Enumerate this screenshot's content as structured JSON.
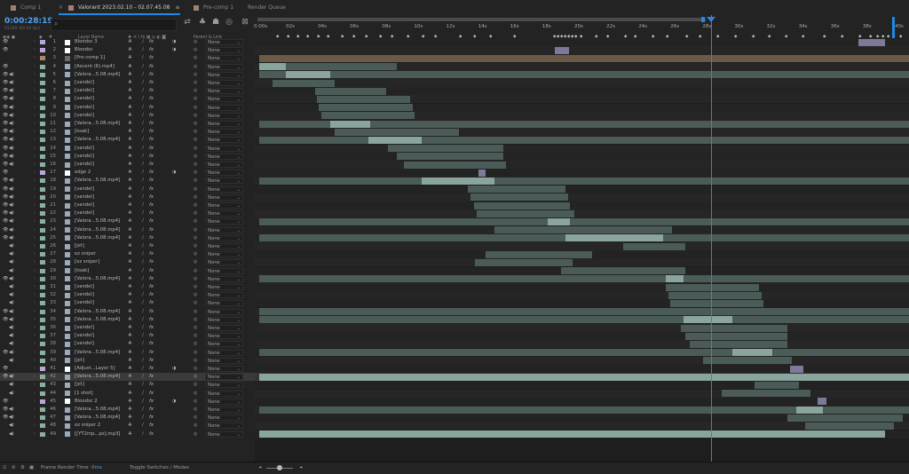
{
  "tabs": [
    {
      "label": "Comp 1",
      "color": "#a08070",
      "active": false
    },
    {
      "label": "Valorant 2023.02.10 - 02.07.45.08",
      "color": "#a08070",
      "active": true
    },
    {
      "label": "Pre-comp 1",
      "color": "#a08070",
      "active": false
    },
    {
      "label": "Render Queue",
      "color": "",
      "active": false
    }
  ],
  "icons": {
    "close": "×",
    "menu": "≡",
    "search": "⌕"
  },
  "timecode": "0:00:28:19",
  "fps": "01189 (60.00 fps)",
  "search": {
    "placeholder": ""
  },
  "columns": {
    "layer_name": "Layer Name",
    "parent_link": "Parent & Link"
  },
  "layers": [
    {
      "num": "1",
      "name": "Bloodsc 3",
      "label": "#b8a8d8",
      "src": "#ffffff",
      "mb": "◑",
      "eye": true,
      "aud": false
    },
    {
      "num": "2",
      "name": "Bloodsc",
      "label": "#b8a8d8",
      "src": "#ffffff",
      "mb": "◑",
      "eye": true,
      "aud": false
    },
    {
      "num": "3",
      "name": "[Pre-comp 1]",
      "label": "#a88870",
      "src": "#6a6a6a",
      "mb": "",
      "eye": false,
      "aud": false
    },
    {
      "num": "4",
      "name": "[Ascent (6).mp4]",
      "label": "#8ab0a0",
      "src": "#9ab",
      "mb": "",
      "eye": true,
      "aud": false
    },
    {
      "num": "5",
      "name": "[Valora...5.08.mp4]",
      "label": "#8ab0a0",
      "src": "#9ab",
      "mb": "",
      "eye": true,
      "aud": true
    },
    {
      "num": "6",
      "name": "[vandel]",
      "label": "#8ab0a0",
      "src": "#9ab",
      "mb": "",
      "eye": true,
      "aud": true
    },
    {
      "num": "7",
      "name": "[vandel]",
      "label": "#8ab0a0",
      "src": "#9ab",
      "mb": "",
      "eye": true,
      "aud": true
    },
    {
      "num": "8",
      "name": "[vandel]",
      "label": "#8ab0a0",
      "src": "#9ab",
      "mb": "",
      "eye": true,
      "aud": true
    },
    {
      "num": "9",
      "name": "[vandel]",
      "label": "#8ab0a0",
      "src": "#9ab",
      "mb": "",
      "eye": true,
      "aud": true
    },
    {
      "num": "10",
      "name": "[vandel]",
      "label": "#8ab0a0",
      "src": "#9ab",
      "mb": "",
      "eye": true,
      "aud": true
    },
    {
      "num": "11",
      "name": "[Valora...5.08.mp4]",
      "label": "#8ab0a0",
      "src": "#9ab",
      "mb": "",
      "eye": true,
      "aud": true
    },
    {
      "num": "12",
      "name": "[ksak]",
      "label": "#8ab0a0",
      "src": "#9ab",
      "mb": "",
      "eye": true,
      "aud": true
    },
    {
      "num": "13",
      "name": "[Valora...5.08.mp4]",
      "label": "#8ab0a0",
      "src": "#9ab",
      "mb": "",
      "eye": true,
      "aud": true
    },
    {
      "num": "14",
      "name": "[vandel]",
      "label": "#8ab0a0",
      "src": "#9ab",
      "mb": "",
      "eye": true,
      "aud": true
    },
    {
      "num": "15",
      "name": "[vandel]",
      "label": "#8ab0a0",
      "src": "#9ab",
      "mb": "",
      "eye": true,
      "aud": true
    },
    {
      "num": "16",
      "name": "[vandel]",
      "label": "#8ab0a0",
      "src": "#9ab",
      "mb": "",
      "eye": true,
      "aud": true
    },
    {
      "num": "17",
      "name": "edge 2",
      "label": "#b8a8d8",
      "src": "#ffffff",
      "mb": "◑",
      "eye": true,
      "aud": false
    },
    {
      "num": "18",
      "name": "[Valora...5.08.mp4]",
      "label": "#8ab0a0",
      "src": "#9ab",
      "mb": "",
      "eye": true,
      "aud": true
    },
    {
      "num": "19",
      "name": "[vandel]",
      "label": "#8ab0a0",
      "src": "#9ab",
      "mb": "",
      "eye": true,
      "aud": true
    },
    {
      "num": "20",
      "name": "[vandel]",
      "label": "#8ab0a0",
      "src": "#9ab",
      "mb": "",
      "eye": true,
      "aud": true
    },
    {
      "num": "21",
      "name": "[vandel]",
      "label": "#8ab0a0",
      "src": "#9ab",
      "mb": "",
      "eye": true,
      "aud": true
    },
    {
      "num": "22",
      "name": "[vandel]",
      "label": "#8ab0a0",
      "src": "#9ab",
      "mb": "",
      "eye": true,
      "aud": true
    },
    {
      "num": "23",
      "name": "[Valora...5.08.mp4]",
      "label": "#8ab0a0",
      "src": "#9ab",
      "mb": "",
      "eye": true,
      "aud": true
    },
    {
      "num": "24",
      "name": "[Valora...5.08.mp4]",
      "label": "#8ab0a0",
      "src": "#9ab",
      "mb": "",
      "eye": true,
      "aud": true
    },
    {
      "num": "25",
      "name": "[Valora...5.08.mp4]",
      "label": "#8ab0a0",
      "src": "#9ab",
      "mb": "",
      "eye": true,
      "aud": true
    },
    {
      "num": "26",
      "name": "[jet]",
      "label": "#8ab0a0",
      "src": "#9ab",
      "mb": "",
      "eye": false,
      "aud": true
    },
    {
      "num": "27",
      "name": "ez sniper",
      "label": "#8ab0a0",
      "src": "#9ab",
      "mb": "",
      "eye": false,
      "aud": true
    },
    {
      "num": "28",
      "name": "[ez sniper]",
      "label": "#8ab0a0",
      "src": "#9ab",
      "mb": "",
      "eye": false,
      "aud": true
    },
    {
      "num": "29",
      "name": "[ksak]",
      "label": "#8ab0a0",
      "src": "#9ab",
      "mb": "",
      "eye": false,
      "aud": true
    },
    {
      "num": "30",
      "name": "[Valora...5.08.mp4]",
      "label": "#8ab0a0",
      "src": "#9ab",
      "mb": "",
      "eye": true,
      "aud": true
    },
    {
      "num": "31",
      "name": "[vandel]",
      "label": "#8ab0a0",
      "src": "#9ab",
      "mb": "",
      "eye": false,
      "aud": true
    },
    {
      "num": "32",
      "name": "[vandel]",
      "label": "#8ab0a0",
      "src": "#9ab",
      "mb": "",
      "eye": false,
      "aud": true
    },
    {
      "num": "33",
      "name": "[vandel]",
      "label": "#8ab0a0",
      "src": "#9ab",
      "mb": "",
      "eye": false,
      "aud": true
    },
    {
      "num": "34",
      "name": "[Valora...5.08.mp4]",
      "label": "#8ab0a0",
      "src": "#9ab",
      "mb": "",
      "eye": true,
      "aud": true
    },
    {
      "num": "35",
      "name": "[Valora...5.08.mp4]",
      "label": "#8ab0a0",
      "src": "#9ab",
      "mb": "",
      "eye": true,
      "aud": true
    },
    {
      "num": "36",
      "name": "[vandel]",
      "label": "#8ab0a0",
      "src": "#9ab",
      "mb": "",
      "eye": false,
      "aud": true
    },
    {
      "num": "37",
      "name": "[vandel]",
      "label": "#8ab0a0",
      "src": "#9ab",
      "mb": "",
      "eye": false,
      "aud": true
    },
    {
      "num": "38",
      "name": "[vandel]",
      "label": "#8ab0a0",
      "src": "#9ab",
      "mb": "",
      "eye": false,
      "aud": true
    },
    {
      "num": "39",
      "name": "[Valora...5.08.mp4]",
      "label": "#8ab0a0",
      "src": "#9ab",
      "mb": "",
      "eye": true,
      "aud": true
    },
    {
      "num": "40",
      "name": "[jet]",
      "label": "#8ab0a0",
      "src": "#9ab",
      "mb": "",
      "eye": false,
      "aud": true
    },
    {
      "num": "41",
      "name": "[Adjust...Layer 5]",
      "label": "#b8a8d8",
      "src": "#ffffff",
      "mb": "◑",
      "eye": true,
      "aud": false
    },
    {
      "num": "42",
      "name": "[Valora...5.08.mp4]",
      "label": "#8ab0a0",
      "src": "#9ab",
      "mb": "",
      "eye": true,
      "aud": true,
      "selected": true
    },
    {
      "num": "43",
      "name": "[jet]",
      "label": "#8ab0a0",
      "src": "#9ab",
      "mb": "",
      "eye": false,
      "aud": true
    },
    {
      "num": "44",
      "name": "[1 shot]",
      "label": "#8ab0a0",
      "src": "#9ab",
      "mb": "",
      "eye": false,
      "aud": true
    },
    {
      "num": "45",
      "name": "Bloodsc 2",
      "label": "#b8a8d8",
      "src": "#ffffff",
      "mb": "◑",
      "eye": true,
      "aud": false
    },
    {
      "num": "46",
      "name": "[Valora...5.08.mp4]",
      "label": "#8ab0a0",
      "src": "#9ab",
      "mb": "",
      "eye": true,
      "aud": true
    },
    {
      "num": "47",
      "name": "[Valora...5.08.mp4]",
      "label": "#8ab0a0",
      "src": "#9ab",
      "mb": "",
      "eye": true,
      "aud": true
    },
    {
      "num": "48",
      "name": "ez sniper 2",
      "label": "#8ab0a0",
      "src": "#9ab",
      "mb": "",
      "eye": false,
      "aud": true
    },
    {
      "num": "49",
      "name": "[[YT2mp...ps].mp3]",
      "label": "#8ab0a0",
      "src": "#9ab",
      "mb": "",
      "eye": false,
      "aud": true
    }
  ],
  "parent_value": "None",
  "ruler_ticks": [
    "0:00s",
    "02s",
    "04s",
    "06s",
    "08s",
    "10s",
    "12s",
    "14s",
    "16s",
    "18s",
    "20s",
    "22s",
    "24s",
    "26s",
    "28s",
    "30s",
    "32s",
    "34s",
    "36s",
    "38s",
    "40s"
  ],
  "playhead_time_s": 28.32,
  "footer": {
    "render_time_label": "Frame Render Time",
    "render_time_value": "0ms",
    "toggle": "Toggle Switches / Modes"
  },
  "colors": {
    "accent": "#1d8ae6",
    "bar_video": "#5c6e6a",
    "bar_audio": "#8aa59e",
    "bar_adjust": "#7f7898"
  }
}
